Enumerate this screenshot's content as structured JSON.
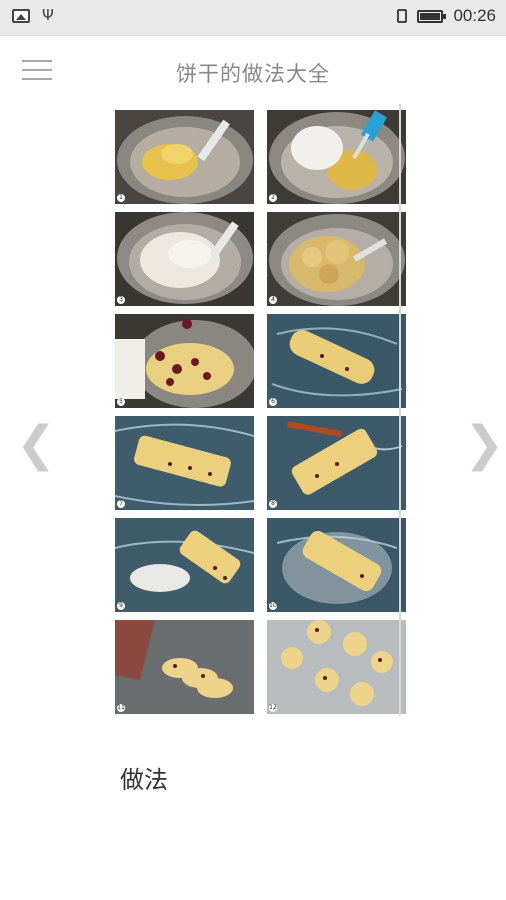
{
  "status_bar": {
    "time": "00:26",
    "icons": [
      "image-notification-icon",
      "usb-icon",
      "sim-icon",
      "battery-icon"
    ]
  },
  "header": {
    "title": "饼干的做法大全",
    "menu_icon": "hamburger-menu-icon"
  },
  "navigation": {
    "prev_icon": "chevron-left-icon",
    "next_icon": "chevron-right-icon",
    "prev_glyph": "❮",
    "next_glyph": "❯"
  },
  "steps": [
    {
      "num": "1",
      "desc": "butter and sugar mixed in bowl with spatula"
    },
    {
      "num": "2",
      "desc": "flour added on top of butter mixture"
    },
    {
      "num": "3",
      "desc": "flour being folded into mixture"
    },
    {
      "num": "4",
      "desc": "crumbly dough in bowl"
    },
    {
      "num": "5",
      "desc": "dough with dried cranberries"
    },
    {
      "num": "6",
      "desc": "dough shaped into log on mat"
    },
    {
      "num": "7",
      "desc": "log of dough on plastic wrap"
    },
    {
      "num": "8",
      "desc": "log being shaped with scraper"
    },
    {
      "num": "9",
      "desc": "log rolled in sugar"
    },
    {
      "num": "10",
      "desc": "log wrapped and chilled"
    },
    {
      "num": "11",
      "desc": "log sliced into rounds"
    },
    {
      "num": "12",
      "desc": "cookie rounds on foil tray"
    }
  ],
  "section": {
    "method_label": "做法"
  },
  "colors": {
    "status_bar_bg": "#e9e9e9",
    "title_gray": "#888888",
    "arrow_gray": "#cccccc"
  }
}
